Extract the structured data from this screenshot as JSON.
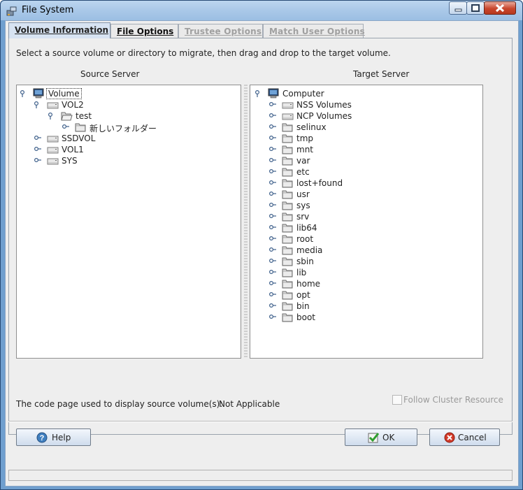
{
  "window": {
    "title": "File System",
    "icon": "file-system-icon"
  },
  "tabs": [
    {
      "label": "Volume Information",
      "state": "active"
    },
    {
      "label": "File Options",
      "state": "normal"
    },
    {
      "label": "Trustee Options",
      "state": "disabled"
    },
    {
      "label": "Match User Options",
      "state": "disabled"
    }
  ],
  "instructions": "Select a source volume or directory to migrate, then drag and drop to the target volume.",
  "source": {
    "header": "Source Server",
    "nodes": [
      {
        "label": "Volume",
        "icon": "computer-icon",
        "depth": 0,
        "expanded": true,
        "selected": true
      },
      {
        "label": "VOL2",
        "icon": "drive-icon",
        "depth": 1,
        "expanded": true
      },
      {
        "label": "test",
        "icon": "folder-open-icon",
        "depth": 2,
        "expanded": true
      },
      {
        "label": "新しいフォルダー",
        "icon": "folder-icon",
        "depth": 3,
        "expanded": false
      },
      {
        "label": "SSDVOL",
        "icon": "drive-icon",
        "depth": 1,
        "expanded": false
      },
      {
        "label": "VOL1",
        "icon": "drive-icon",
        "depth": 1,
        "expanded": false
      },
      {
        "label": "SYS",
        "icon": "drive-icon",
        "depth": 1,
        "expanded": false
      }
    ]
  },
  "target": {
    "header": "Target Server",
    "nodes": [
      {
        "label": "Computer",
        "icon": "computer-icon",
        "depth": 0,
        "expanded": true
      },
      {
        "label": "NSS Volumes",
        "icon": "drive-icon",
        "depth": 1
      },
      {
        "label": "NCP Volumes",
        "icon": "drive-icon",
        "depth": 1
      },
      {
        "label": "selinux",
        "icon": "folder-icon",
        "depth": 1
      },
      {
        "label": "tmp",
        "icon": "folder-icon",
        "depth": 1
      },
      {
        "label": "mnt",
        "icon": "folder-icon",
        "depth": 1
      },
      {
        "label": "var",
        "icon": "folder-icon",
        "depth": 1
      },
      {
        "label": "etc",
        "icon": "folder-icon",
        "depth": 1
      },
      {
        "label": "lost+found",
        "icon": "folder-icon",
        "depth": 1
      },
      {
        "label": "usr",
        "icon": "folder-icon",
        "depth": 1
      },
      {
        "label": "sys",
        "icon": "folder-icon",
        "depth": 1
      },
      {
        "label": "srv",
        "icon": "folder-icon",
        "depth": 1
      },
      {
        "label": "lib64",
        "icon": "folder-icon",
        "depth": 1
      },
      {
        "label": "root",
        "icon": "folder-icon",
        "depth": 1
      },
      {
        "label": "media",
        "icon": "folder-icon",
        "depth": 1
      },
      {
        "label": "sbin",
        "icon": "folder-icon",
        "depth": 1
      },
      {
        "label": "lib",
        "icon": "folder-icon",
        "depth": 1
      },
      {
        "label": "home",
        "icon": "folder-icon",
        "depth": 1
      },
      {
        "label": "opt",
        "icon": "folder-icon",
        "depth": 1
      },
      {
        "label": "bin",
        "icon": "folder-icon",
        "depth": 1
      },
      {
        "label": "boot",
        "icon": "folder-icon",
        "depth": 1
      }
    ]
  },
  "codepage": {
    "label": "The code page used to display source volume(s):",
    "value": "Not Applicable"
  },
  "follow_cluster": {
    "label": "Follow Cluster Resource",
    "checked": false,
    "enabled": false
  },
  "buttons": {
    "help": "Help",
    "ok": "OK",
    "cancel": "Cancel"
  },
  "colors": {
    "title_bar": "#a9c8e8",
    "active_tab": "#d7e3f2",
    "ok_icon": "#2f9e2f",
    "cancel_icon": "#d23a2a",
    "help_icon": "#3f7fc0"
  }
}
